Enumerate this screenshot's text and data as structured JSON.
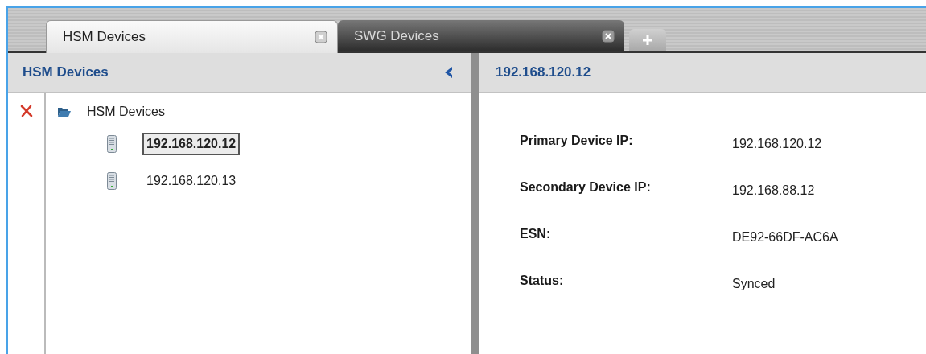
{
  "tabs": [
    {
      "label": "HSM Devices",
      "selected": true
    },
    {
      "label": "SWG Devices",
      "selected": false
    }
  ],
  "sidebar": {
    "title": "HSM Devices",
    "tree": [
      {
        "label": "HSM Devices",
        "kind": "folder",
        "selected": false,
        "expanded": true,
        "children": [
          {
            "label": "192.168.120.12",
            "kind": "device",
            "selected": true
          },
          {
            "label": "192.168.120.13",
            "kind": "device",
            "selected": false
          }
        ]
      }
    ]
  },
  "detail": {
    "title": "192.168.120.12",
    "fields": [
      {
        "label": "Primary Device IP:",
        "value": "192.168.120.12"
      },
      {
        "label": "Secondary Device IP:",
        "value": "192.168.88.12"
      },
      {
        "label": "ESN:",
        "value": "DE92-66DF-AC6A"
      },
      {
        "label": "Status:",
        "value": "Synced"
      }
    ]
  }
}
